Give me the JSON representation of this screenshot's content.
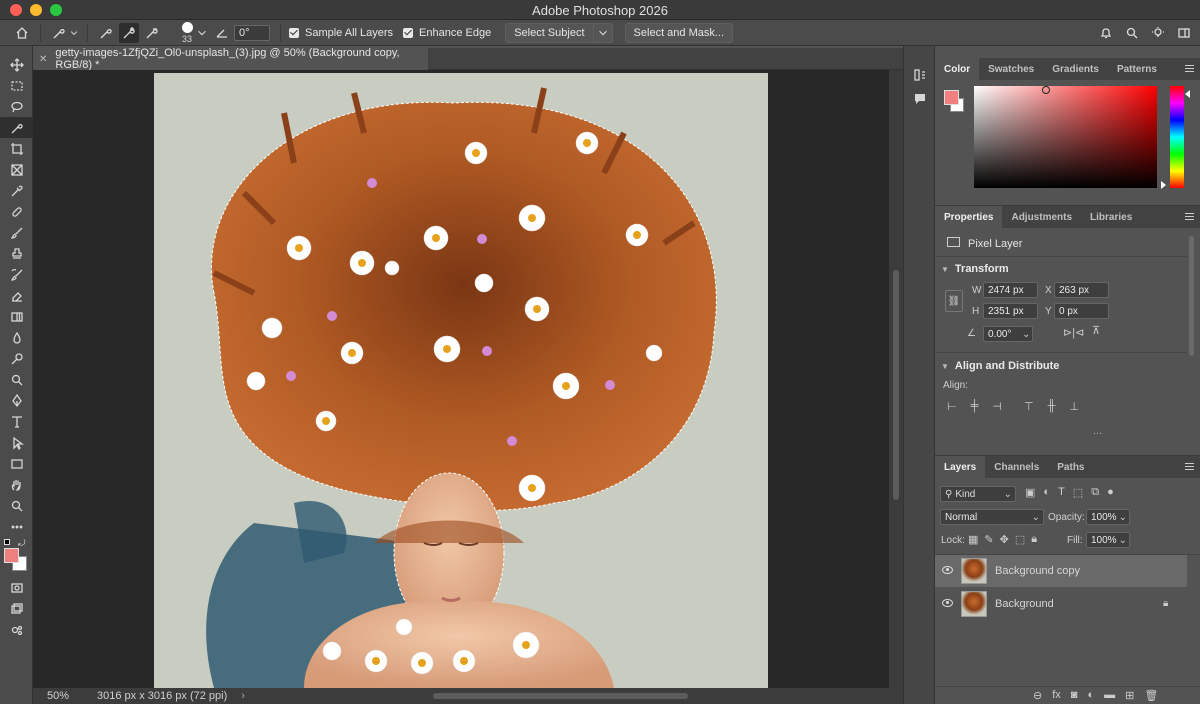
{
  "window": {
    "title": "Adobe Photoshop 2026"
  },
  "options_bar": {
    "brush_size": "33",
    "angle": "0°",
    "sample_all_layers": "Sample All Layers",
    "enhance_edge": "Enhance Edge",
    "select_subject": "Select Subject",
    "select_and_mask": "Select and Mask..."
  },
  "document": {
    "tab_title": "getty-images-1ZfjQZi_Ol0-unsplash_(3).jpg @ 50% (Background copy, RGB/8) *"
  },
  "status": {
    "zoom": "50%",
    "info": "3016 px x 3016 px (72 ppi)"
  },
  "color_panel": {
    "tabs": [
      "Color",
      "Swatches",
      "Gradients",
      "Patterns"
    ],
    "foreground": "#f08080",
    "background": "#ffffff"
  },
  "properties": {
    "tabs": [
      "Properties",
      "Adjustments",
      "Libraries"
    ],
    "layer_type": "Pixel Layer",
    "transform_title": "Transform",
    "w_label": "W",
    "w": "2474 px",
    "h_label": "H",
    "h": "2351 px",
    "x_label": "X",
    "x": "263 px",
    "y_label": "Y",
    "y": "0 px",
    "angle": "0.00°",
    "align_title": "Align and Distribute",
    "align_label": "Align:",
    "more": "..."
  },
  "layers": {
    "tabs": [
      "Layers",
      "Channels",
      "Paths"
    ],
    "kind": "Kind",
    "blend": "Normal",
    "opacity_label": "Opacity:",
    "opacity": "100%",
    "lock_label": "Lock:",
    "fill_label": "Fill:",
    "fill": "100%",
    "items": [
      {
        "name": "Background copy"
      },
      {
        "name": "Background"
      }
    ]
  }
}
